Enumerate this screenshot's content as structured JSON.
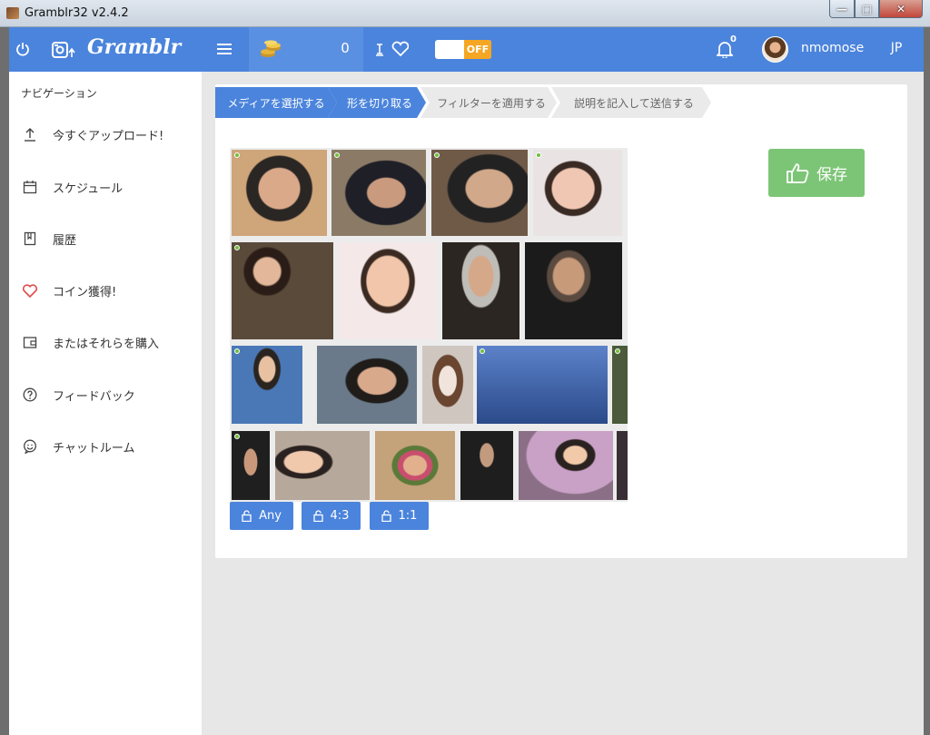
{
  "window": {
    "title": "Gramblr32 v2.4.2",
    "min": "—",
    "max": "□",
    "close": "✕"
  },
  "header": {
    "logo": "Gramblr",
    "coins": "0",
    "toggle_label": "OFF",
    "notification_count": "0",
    "username": "nmomose",
    "language": "JP"
  },
  "sidebar": {
    "title": "ナビゲーション",
    "items": [
      {
        "label": "今すぐアップロード!",
        "icon": "upload-icon"
      },
      {
        "label": "スケジュール",
        "icon": "calendar-icon"
      },
      {
        "label": "履歴",
        "icon": "history-icon"
      },
      {
        "label": "コイン獲得!",
        "icon": "heart-icon"
      },
      {
        "label": "またはそれらを購入",
        "icon": "wallet-icon"
      },
      {
        "label": "フィードバック",
        "icon": "question-icon"
      },
      {
        "label": "チャットルーム",
        "icon": "chat-icon"
      }
    ]
  },
  "steps": [
    {
      "label": "メディアを選択する",
      "active": true
    },
    {
      "label": "形を切り取る",
      "active": true
    },
    {
      "label": "フィルターを適用する",
      "active": false
    },
    {
      "label": "説明を記入して送信する",
      "active": false
    }
  ],
  "save_button": {
    "label": "保存"
  },
  "crop_buttons": [
    {
      "label": "Any"
    },
    {
      "label": "4:3"
    },
    {
      "label": "1:1"
    }
  ],
  "colors": {
    "primary": "#4b84dc",
    "save_green": "#7cc576",
    "toggle_orange": "#f5a623",
    "heart_red": "#e04848"
  }
}
